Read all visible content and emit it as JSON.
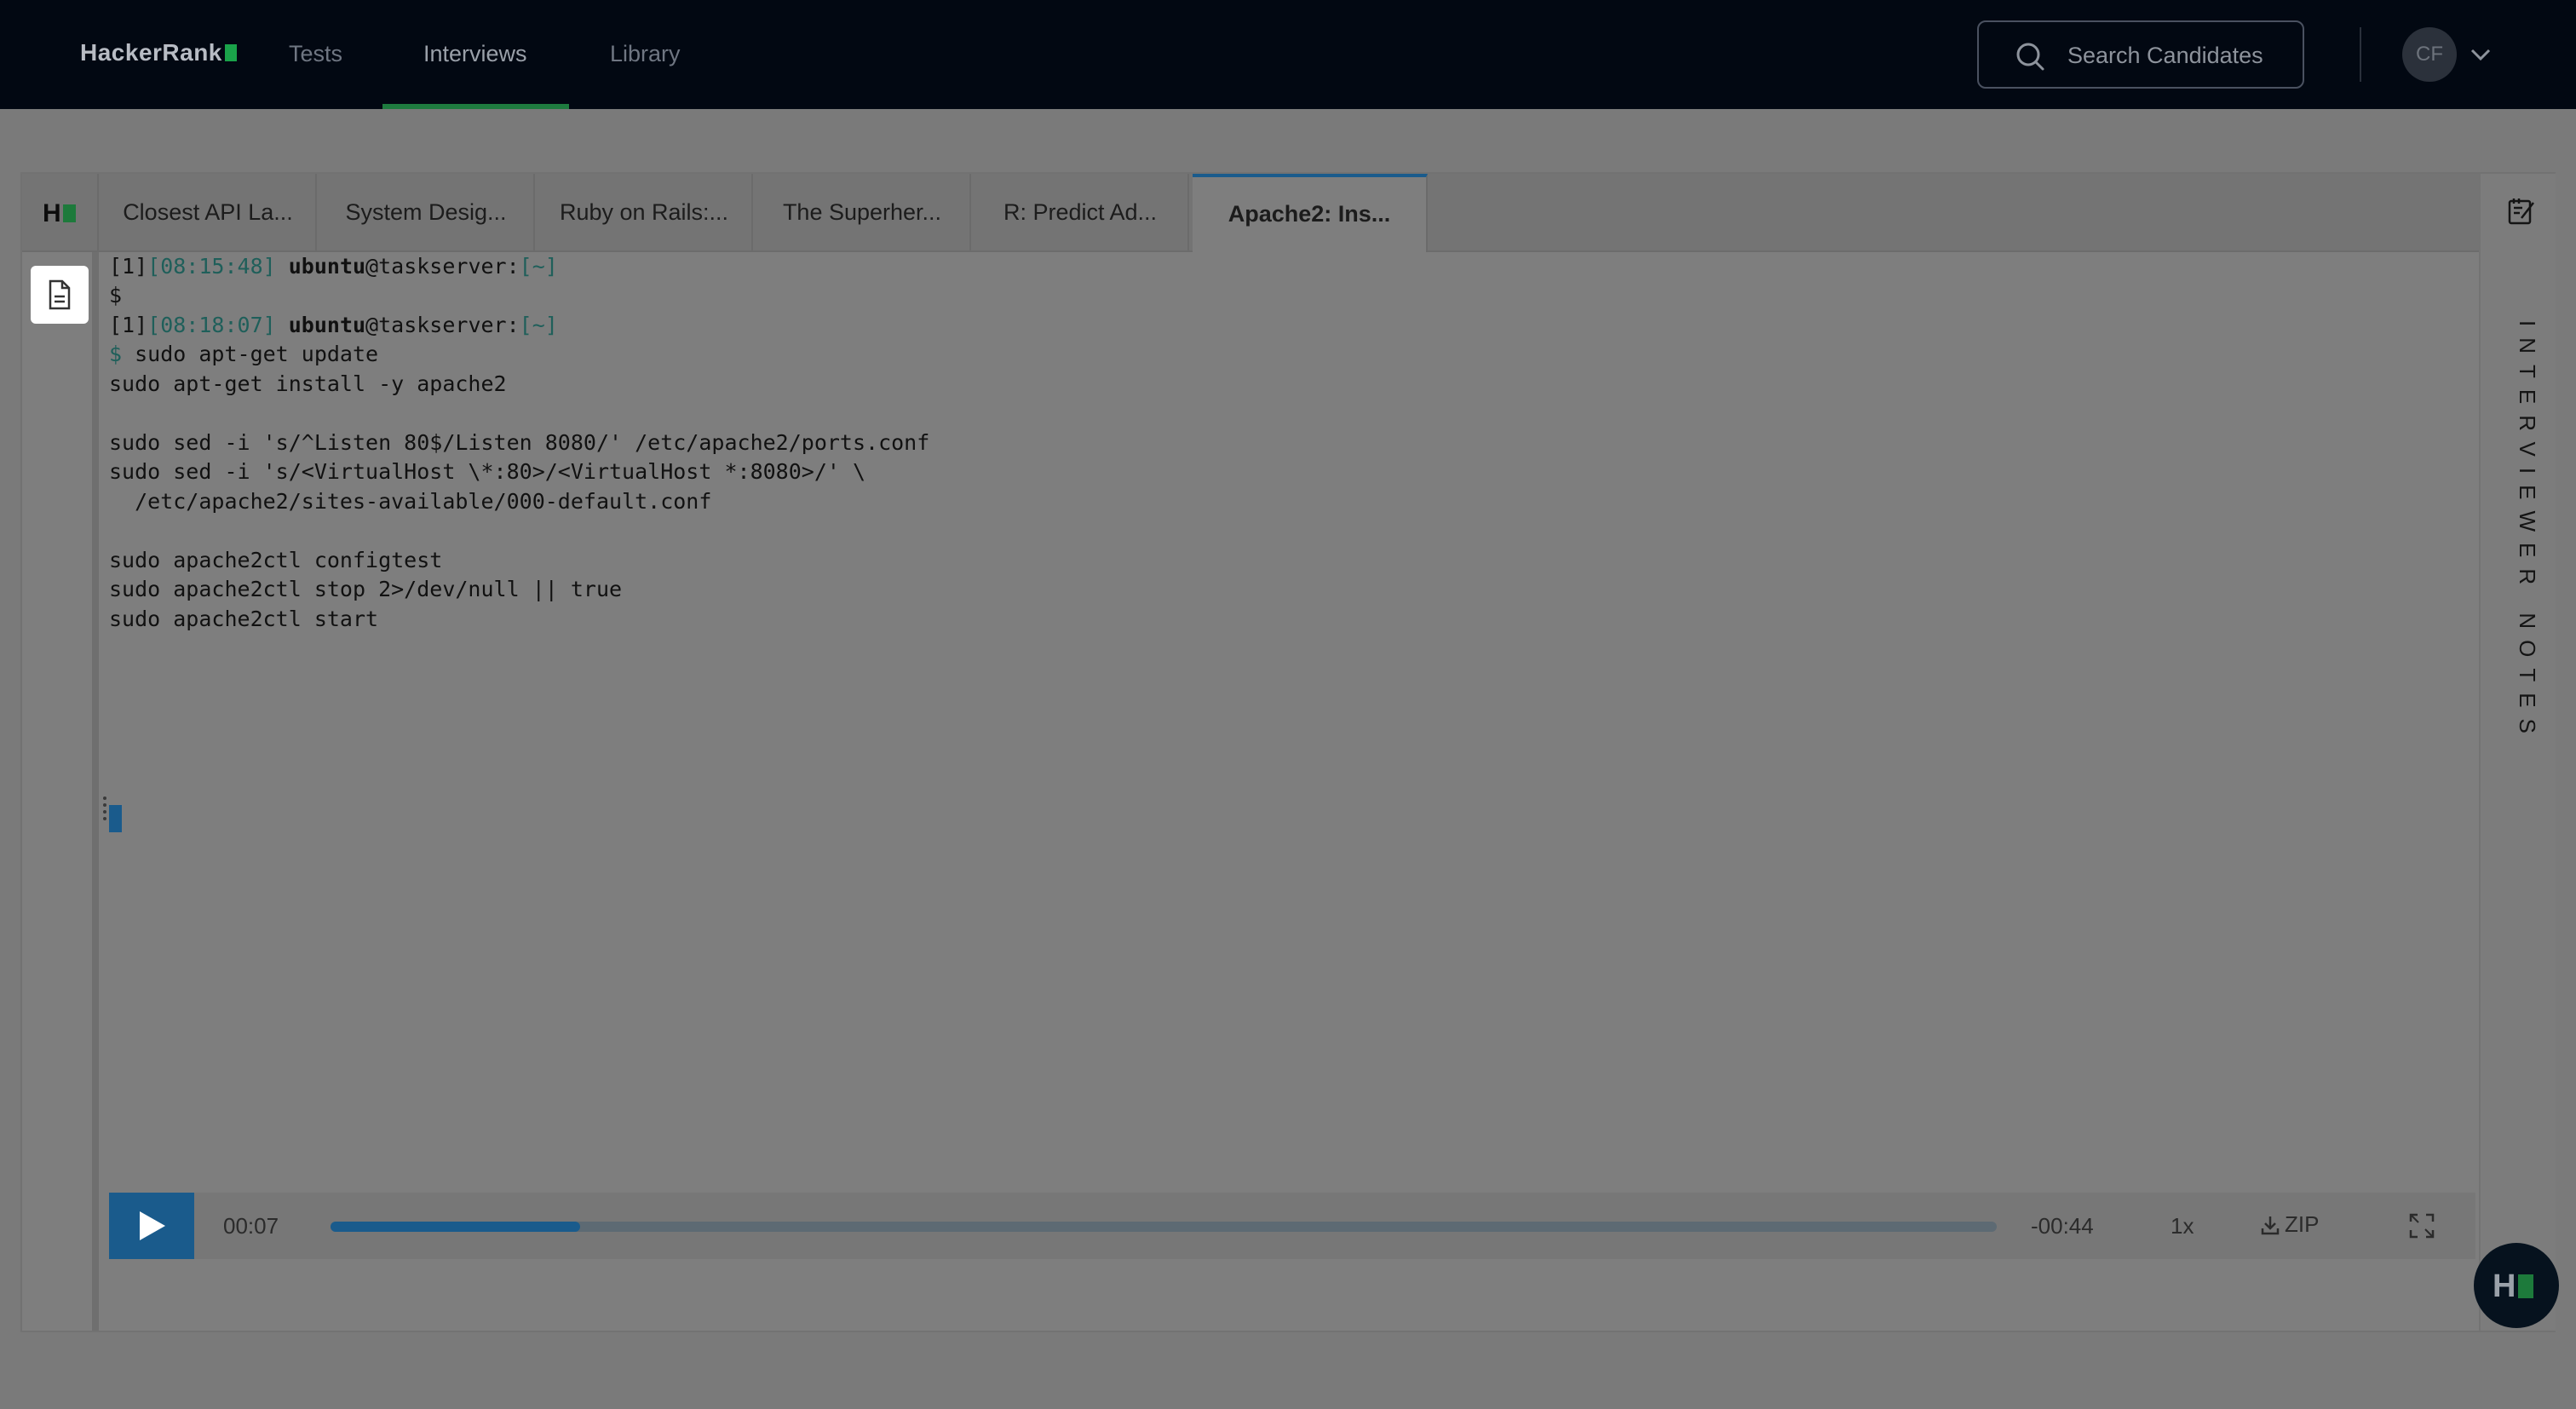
{
  "nav": {
    "brand": "HackerRank",
    "links": [
      "Tests",
      "Interviews",
      "Library"
    ],
    "active": "Interviews",
    "search_label": "Search Candidates",
    "avatar_initials": "CF"
  },
  "tabs": [
    "Closest API La...",
    "System Desig...",
    "Ruby on Rails:...",
    "The Superher...",
    "R: Predict Ad...",
    "Apache2: Ins..."
  ],
  "active_tab": "Apache2: Ins...",
  "sidebar": {
    "notes_label": "INTERVIEWER NOTES"
  },
  "terminal": {
    "prompt1": {
      "index": "[1]",
      "time": "[08:15:48]",
      "user": "ubuntu",
      "host": "@taskserver:",
      "path": "[~]",
      "dollar": "$"
    },
    "prompt2": {
      "index": "[1]",
      "time": "[08:18:07]",
      "user": "ubuntu",
      "host": "@taskserver:",
      "path": "[~]",
      "dollar": "$",
      "command": " sudo apt-get update"
    },
    "lines": [
      "sudo apt-get install -y apache2",
      "",
      "sudo sed -i 's/^Listen 80$/Listen 8080/' /etc/apache2/ports.conf",
      "sudo sed -i 's/<VirtualHost \\*:80>/<VirtualHost *:8080>/' \\",
      "  /etc/apache2/sites-available/000-default.conf",
      "",
      "sudo apache2ctl configtest",
      "sudo apache2ctl stop 2>/dev/null || true",
      "sudo apache2ctl start"
    ]
  },
  "player": {
    "current_time": "00:07",
    "remaining_time": "-00:44",
    "progress": 0.15,
    "speed": "1x",
    "download_label": "ZIP"
  }
}
